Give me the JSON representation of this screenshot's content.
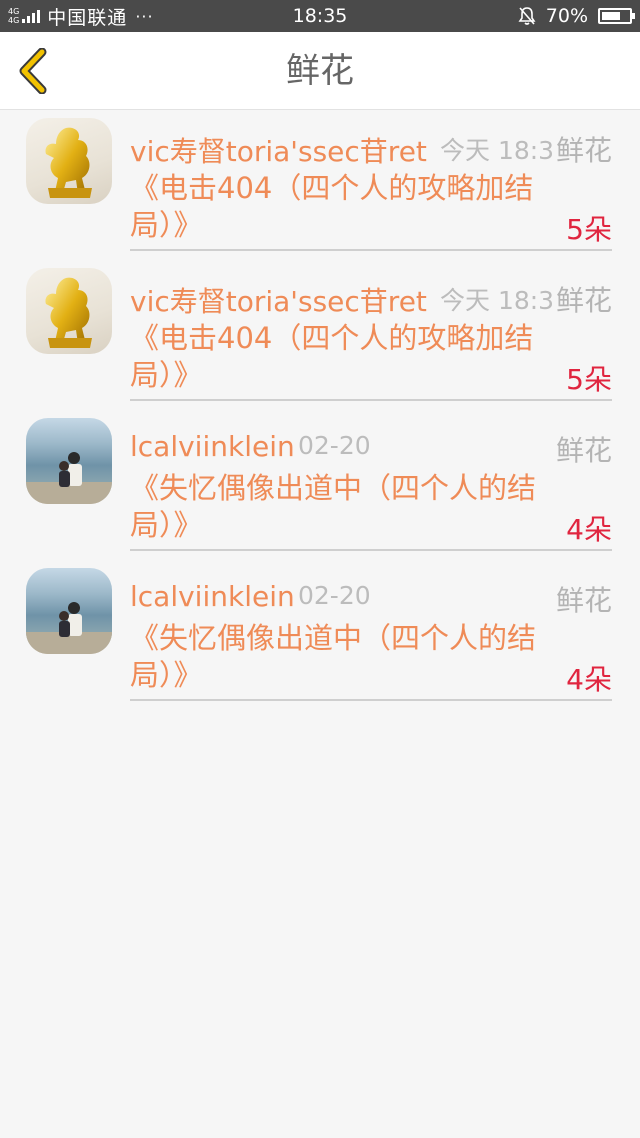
{
  "status_bar": {
    "network_top": "4G",
    "network_bottom": "4G",
    "carrier": "中国联通",
    "more": "···",
    "time": "18:35",
    "battery_text": "70%",
    "battery_level": 0.7,
    "icons": [
      "signal-icon",
      "bell-muted-icon",
      "battery-icon"
    ]
  },
  "nav": {
    "title": "鲜花",
    "back_icon": "chevron-left-icon",
    "back_color": "#f2c200"
  },
  "items": [
    {
      "name": "vic寿督toria'ssec苷ret",
      "time": "今天 18:3",
      "tag": "鲜花",
      "title": "《电击404（四个人的攻略加结局）》",
      "count": "5朵",
      "avatar": "golden-horse"
    },
    {
      "name": "vic寿督toria'ssec苷ret",
      "time": "今天 18:3",
      "tag": "鲜花",
      "title": "《电击404（四个人的攻略加结局）》",
      "count": "5朵",
      "avatar": "golden-horse"
    },
    {
      "name": "lcalviinklein",
      "time": "02-20",
      "tag": "鲜花",
      "title": "《失忆偶像出道中（四个人的结局）》",
      "count": "4朵",
      "avatar": "beach-couple"
    },
    {
      "name": "lcalviinklein",
      "time": "02-20",
      "tag": "鲜花",
      "title": "《失忆偶像出道中（四个人的结局）》",
      "count": "4朵",
      "avatar": "beach-couple"
    }
  ],
  "colors": {
    "accent_orange": "#ef8b57",
    "count_red": "#e0253f",
    "meta_gray": "#bcbcbc",
    "status_bar_bg": "#4a4a4a"
  }
}
